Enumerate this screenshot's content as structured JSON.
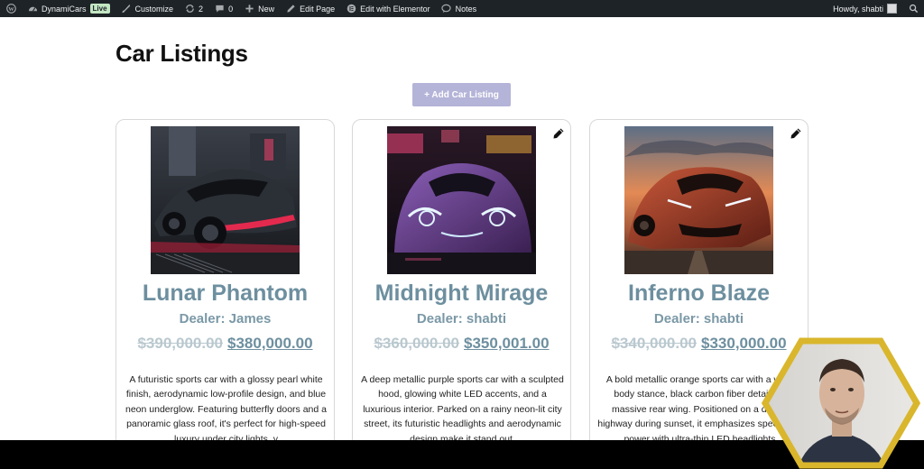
{
  "adminbar": {
    "site_name": "DynamiCars",
    "live_badge": "Live",
    "customize": "Customize",
    "updates_count": "2",
    "comments_count": "0",
    "new": "New",
    "edit_page": "Edit Page",
    "edit_elementor": "Edit with Elementor",
    "notes": "Notes",
    "howdy": "Howdy, shabti"
  },
  "page": {
    "title": "Car Listings",
    "add_button": "+ Add Car Listing"
  },
  "cars": [
    {
      "name": "Lunar Phantom",
      "dealer": "Dealer: James",
      "old_price": "$390,000.00",
      "new_price": "$380,000.00",
      "description": "A futuristic sports car with a glossy pearl white finish, aerodynamic low-profile design, and blue neon underglow. Featuring butterfly doors and a panoramic glass roof, it's perfect for high-speed luxury under city lights, y"
    },
    {
      "name": "Midnight Mirage",
      "dealer": "Dealer: shabti",
      "old_price": "$360,000.00",
      "new_price": "$350,001.00",
      "description": "A deep metallic purple sports car with a sculpted hood, glowing white LED accents, and a luxurious interior. Parked on a rainy neon-lit city street, its futuristic headlights and aerodynamic design make it stand out."
    },
    {
      "name": "Inferno Blaze",
      "dealer": "Dealer: shabti",
      "old_price": "$340,000.00",
      "new_price": "$330,000.00",
      "description": "A bold metallic orange sports car with a wide body stance, black carbon fiber details, a massive rear wing. Positioned on a desert highway during sunset, it emphasizes speed and power with ultra-thin LED headlights"
    }
  ],
  "colors": {
    "adminbar_bg": "#1d2327",
    "button_bg": "#b4b3d8",
    "heading_blue": "#6d8f9f",
    "webcam_border": "#d9b62c"
  }
}
